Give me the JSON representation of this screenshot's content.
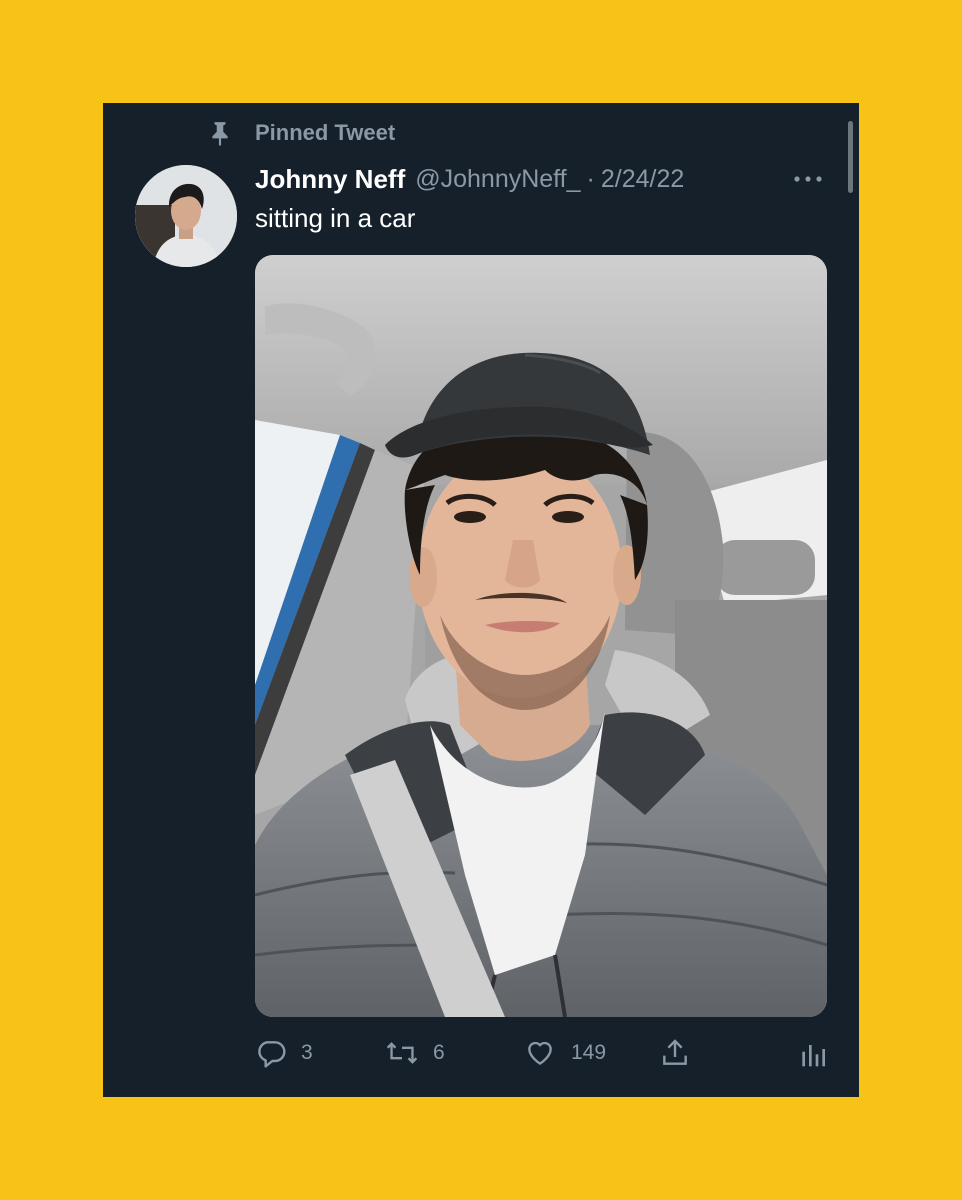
{
  "colors": {
    "background": "#f7c317",
    "card": "#15202b",
    "text_primary": "#ffffff",
    "text_secondary": "#8b98a5"
  },
  "pinned": {
    "icon": "pin-icon",
    "label": "Pinned Tweet"
  },
  "tweet": {
    "display_name": "Johnny Neff",
    "handle": "@JohnnyNeff_",
    "separator": "·",
    "date": "2/24/22",
    "text": "sitting in a car",
    "more_icon": "more-horizontal-icon",
    "media": "selfie photo of man in cap sitting in car"
  },
  "actions": {
    "reply": {
      "icon": "reply-icon",
      "count": "3"
    },
    "retweet": {
      "icon": "retweet-icon",
      "count": "6"
    },
    "like": {
      "icon": "heart-icon",
      "count": "149"
    },
    "share": {
      "icon": "share-icon"
    },
    "analytics": {
      "icon": "analytics-icon"
    }
  }
}
